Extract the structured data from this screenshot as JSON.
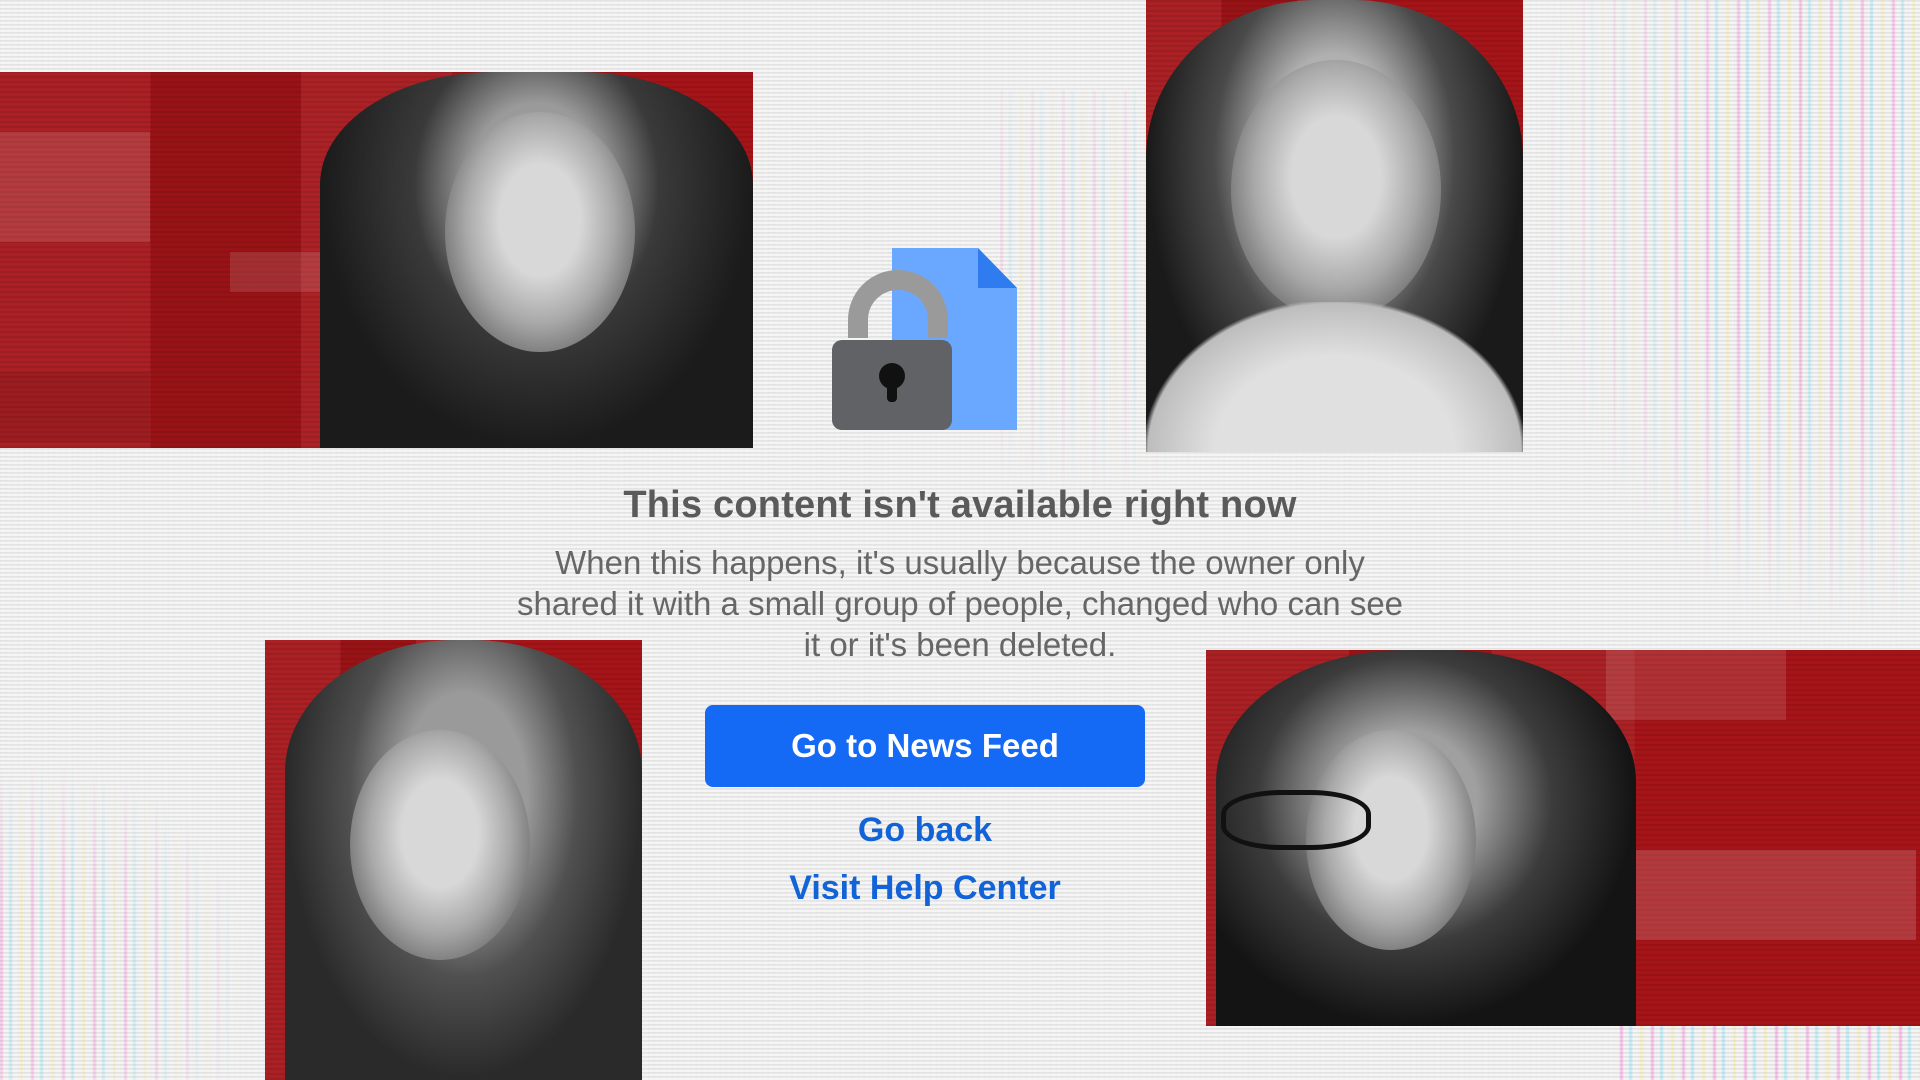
{
  "message": {
    "title": "This content isn't available right now",
    "description": "When this happens, it's usually because the owner only shared it with a small group of people, changed who can see it or it's been deleted."
  },
  "actions": {
    "primary_label": "Go to News Feed",
    "go_back_label": "Go back",
    "help_label": "Visit Help Center"
  },
  "icons": {
    "content_icon": "lock-document-icon"
  },
  "colors": {
    "primary_button": "#1469f5",
    "link": "#1363d8",
    "panel_red": "#a51418",
    "document_blue": "#6aa8ff",
    "lock_gray": "#606266"
  }
}
